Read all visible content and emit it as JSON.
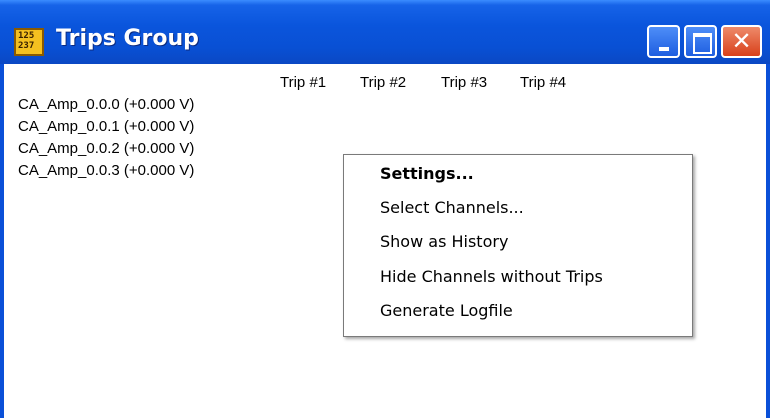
{
  "window": {
    "title": "Trips Group",
    "icon_text": [
      "125",
      "237"
    ]
  },
  "trips": {
    "headers": [
      "Trip #1",
      "Trip #2",
      "Trip #3",
      "Trip #4"
    ]
  },
  "channels": [
    "CA_Amp_0.0.0 (+0.000 V)",
    "CA_Amp_0.0.1 (+0.000 V)",
    "CA_Amp_0.0.2 (+0.000 V)",
    "CA_Amp_0.0.3 (+0.000 V)"
  ],
  "context_menu": {
    "items": [
      "Settings...",
      "Select Channels...",
      "Show as History",
      "Hide Channels without Trips",
      "Generate Logfile"
    ]
  },
  "titlebar_buttons": {
    "close_glyph": "✕"
  }
}
